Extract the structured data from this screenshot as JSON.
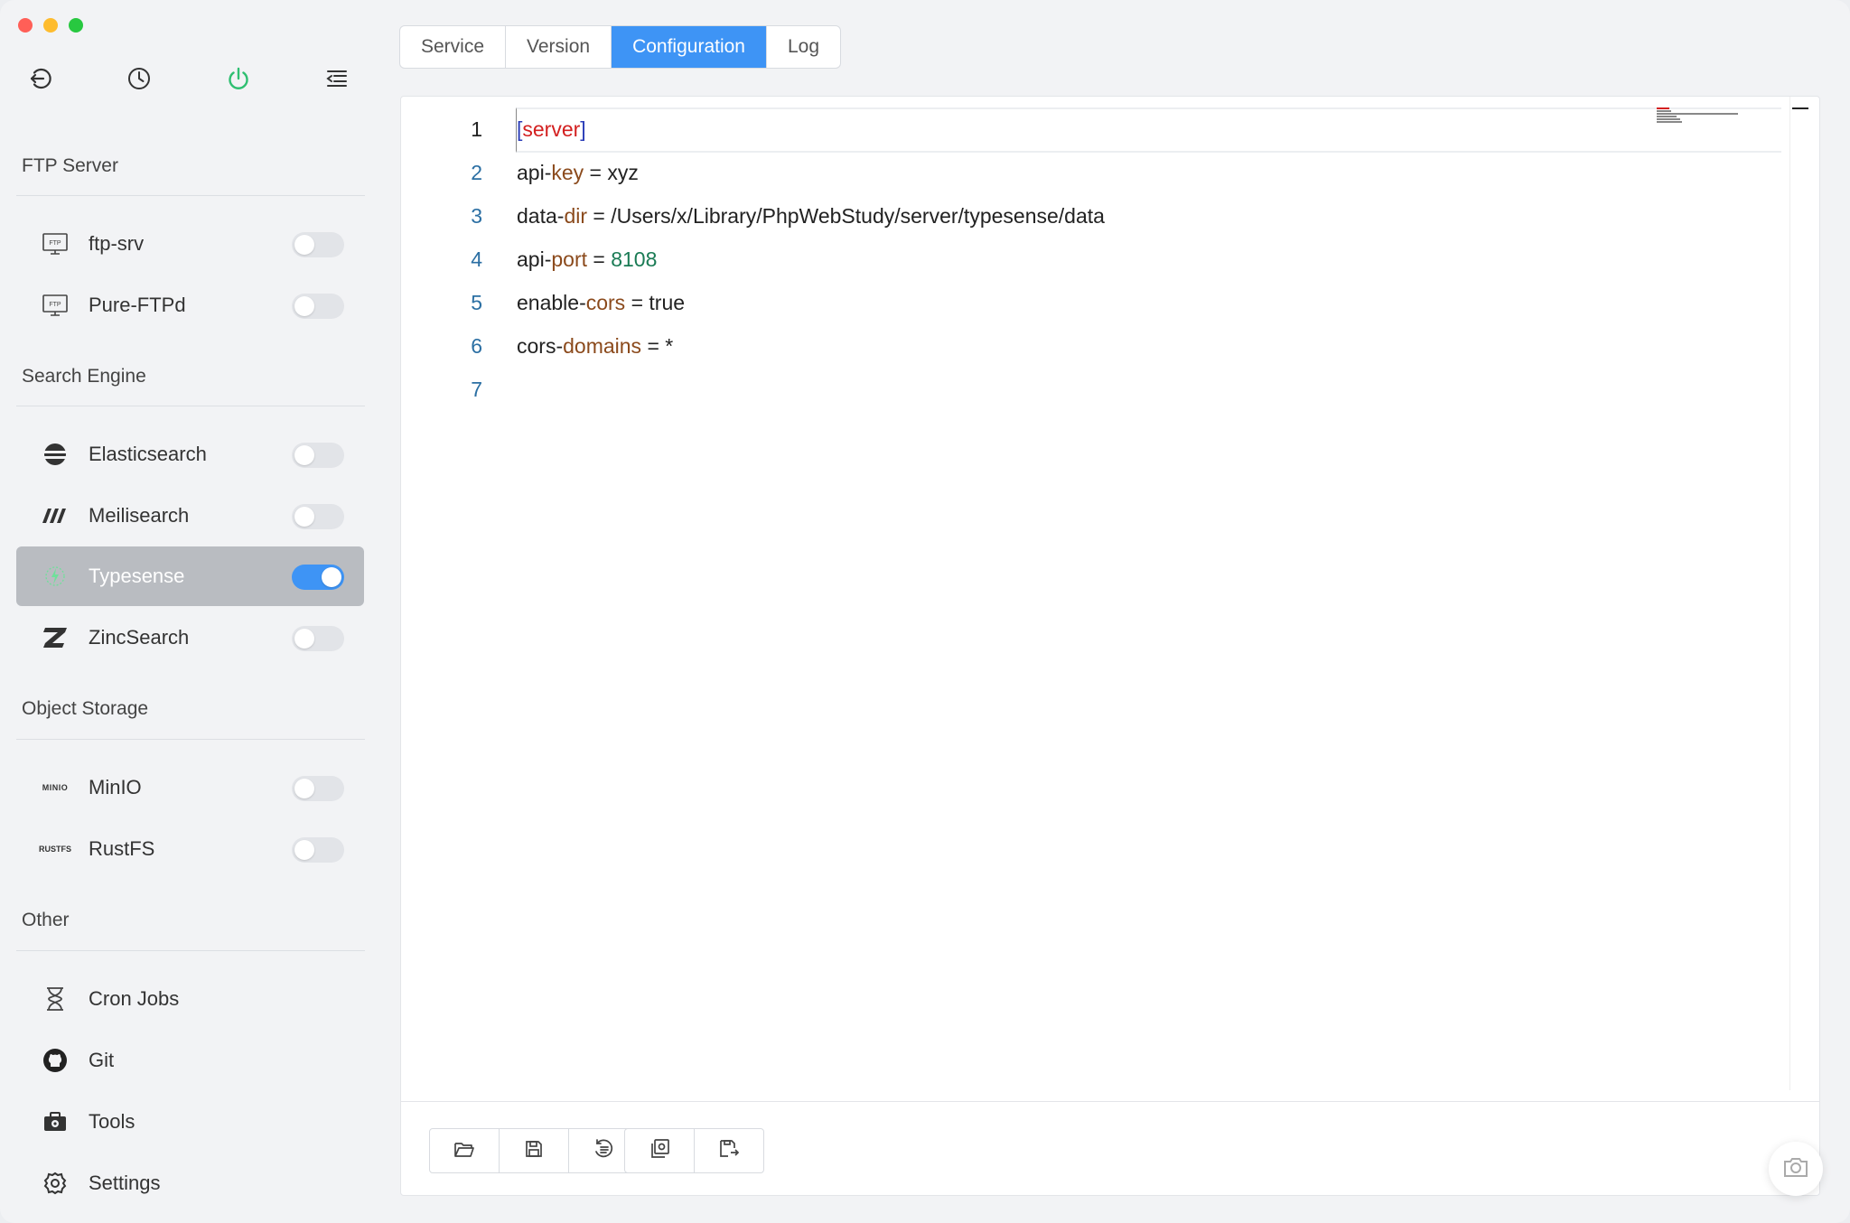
{
  "toolbar": {
    "icons": [
      "back-icon",
      "history-icon",
      "power-icon",
      "menu-icon"
    ]
  },
  "sidebar": {
    "sections": [
      {
        "title": "FTP Server"
      },
      {
        "title": "Search Engine"
      },
      {
        "title": "Object Storage"
      },
      {
        "title": "Other"
      }
    ],
    "items": [
      {
        "label": "ftp-srv",
        "icon": "ftp-icon",
        "enabled": false
      },
      {
        "label": "Pure-FTPd",
        "icon": "ftp-icon",
        "enabled": false
      },
      {
        "label": "Elasticsearch",
        "icon": "elasticsearch-icon",
        "enabled": false
      },
      {
        "label": "Meilisearch",
        "icon": "meilisearch-icon",
        "enabled": false
      },
      {
        "label": "Typesense",
        "icon": "typesense-icon",
        "enabled": true,
        "selected": true
      },
      {
        "label": "ZincSearch",
        "icon": "zincsearch-icon",
        "enabled": false
      },
      {
        "label": "MinIO",
        "icon": "minio-logo",
        "logo_text": "MINIO",
        "enabled": false
      },
      {
        "label": "RustFS",
        "icon": "rustfs-logo",
        "logo_text": "RUSTFS",
        "enabled": false
      },
      {
        "label": "Cron Jobs",
        "icon": "hourglass-icon"
      },
      {
        "label": "Git",
        "icon": "github-icon"
      },
      {
        "label": "Tools",
        "icon": "toolbox-icon"
      },
      {
        "label": "Settings",
        "icon": "gear-icon"
      }
    ]
  },
  "tabs": [
    {
      "label": "Service"
    },
    {
      "label": "Version"
    },
    {
      "label": "Configuration",
      "active": true
    },
    {
      "label": "Log"
    }
  ],
  "editor": {
    "current_line": 1,
    "lines": [
      {
        "n": "1",
        "tokens": [
          {
            "t": "[",
            "c": "br"
          },
          {
            "t": "server",
            "c": "sec"
          },
          {
            "t": "]",
            "c": "br"
          }
        ]
      },
      {
        "n": "2",
        "tokens": [
          {
            "t": "api-",
            "c": ""
          },
          {
            "t": "key",
            "c": "k"
          },
          {
            "t": " = xyz",
            "c": ""
          }
        ]
      },
      {
        "n": "3",
        "tokens": [
          {
            "t": "data-",
            "c": ""
          },
          {
            "t": "dir",
            "c": "k"
          },
          {
            "t": " = /Users/x/Library/PhpWebStudy/server/typesense/data",
            "c": ""
          }
        ]
      },
      {
        "n": "4",
        "tokens": [
          {
            "t": "api-",
            "c": ""
          },
          {
            "t": "port",
            "c": "k"
          },
          {
            "t": " = ",
            "c": ""
          },
          {
            "t": "8108",
            "c": "num"
          }
        ]
      },
      {
        "n": "5",
        "tokens": [
          {
            "t": "enable-",
            "c": ""
          },
          {
            "t": "cors",
            "c": "k"
          },
          {
            "t": " = true",
            "c": ""
          }
        ]
      },
      {
        "n": "6",
        "tokens": [
          {
            "t": "cors-",
            "c": ""
          },
          {
            "t": "domains",
            "c": "k"
          },
          {
            "t": " = *",
            "c": ""
          }
        ]
      },
      {
        "n": "7",
        "tokens": []
      }
    ]
  },
  "footer_buttons": {
    "group1": [
      "open-folder-icon",
      "save-icon",
      "format-icon"
    ],
    "group2": [
      "load-custom-icon",
      "save-custom-icon"
    ]
  },
  "fab": {
    "icon": "camera-icon"
  },
  "colors": {
    "accent": "#3e94f5",
    "key": "#8b4a1c",
    "section": "#d32020",
    "number": "#1a7b55",
    "line_number": "#2b6fa3"
  }
}
